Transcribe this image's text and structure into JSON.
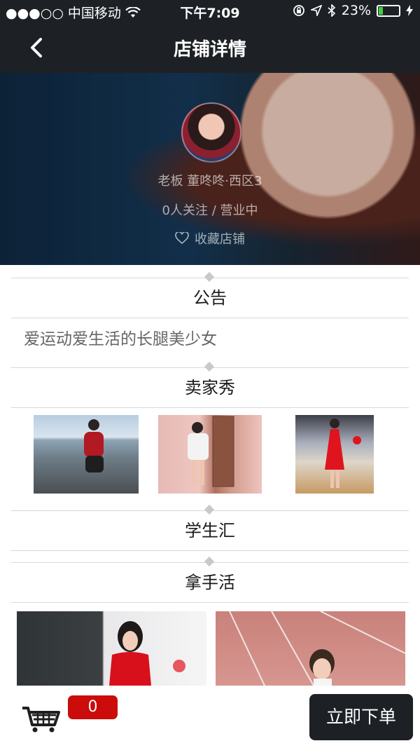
{
  "status_bar": {
    "carrier": "●●●○○ 中国移动",
    "time": "下午7:09",
    "battery": "23%",
    "battery_level": 0.23
  },
  "nav": {
    "title": "店铺详情",
    "back_icon": "chevron-left-icon"
  },
  "shop": {
    "owner": "老板 董咚咚·西区3",
    "stats": "0人关注 / 营业中",
    "favorite_label": "收藏店铺",
    "favorite_icon": "heart-outline-icon"
  },
  "sections": {
    "notice_title": "公告",
    "notice_text": "爱运动爱生活的长腿美少女",
    "seller_show_title": "卖家秀",
    "student_title": "学生汇",
    "specialty_title": "拿手活"
  },
  "footer": {
    "cart_icon": "shopping-cart-icon",
    "cart_count": "0",
    "order_button": "立即下单"
  },
  "colors": {
    "bar_bg": "#1d2126",
    "badge_red": "#cc0b0b",
    "battery_green": "#3fd13f"
  }
}
